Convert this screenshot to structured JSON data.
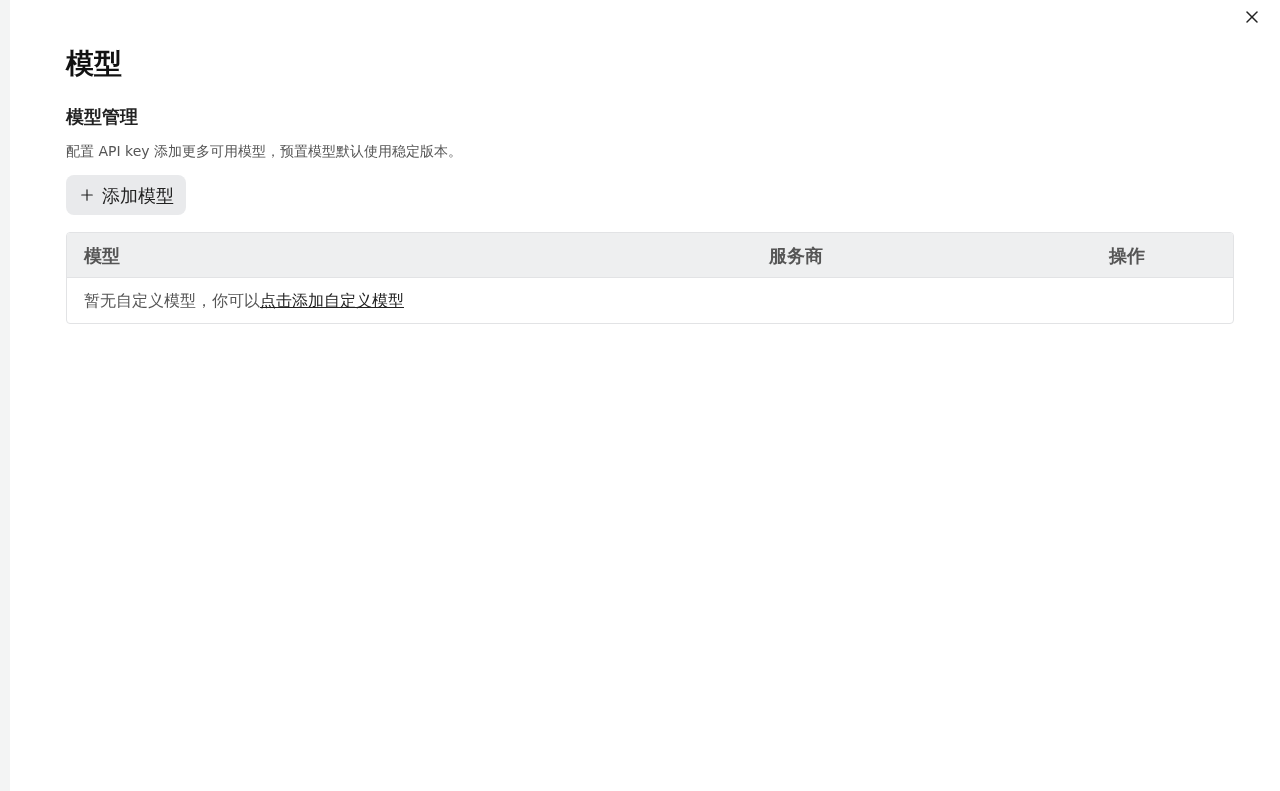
{
  "title": "模型",
  "section": {
    "heading": "模型管理",
    "description": "配置 API key 添加更多可用模型，预置模型默认使用稳定版本。",
    "add_button": "添加模型"
  },
  "table": {
    "columns": [
      "模型",
      "服务商",
      "操作"
    ],
    "empty": {
      "text": "暂无自定义模型，你可以",
      "link": "点击添加自定义模型"
    }
  }
}
